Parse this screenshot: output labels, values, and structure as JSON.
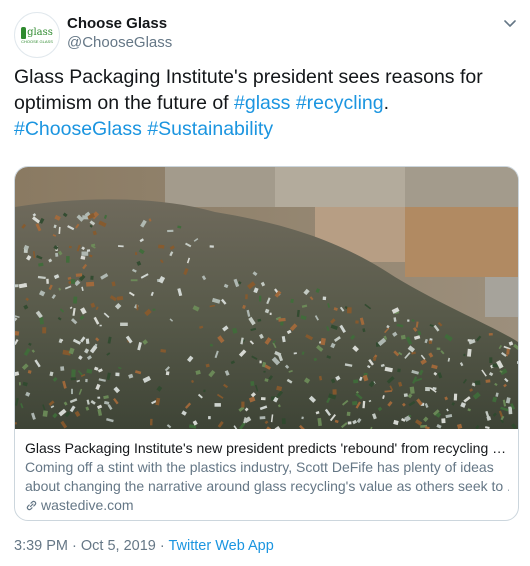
{
  "author": {
    "name": "Choose Glass",
    "handle": "@ChooseGlass",
    "avatar_text": "glass",
    "avatar_subtext": "CHOOSE GLASS"
  },
  "tweet": {
    "text_main": "Glass Packaging Institute's president sees reasons for optimism on the future of ",
    "hashtag_glass": "#glass",
    "hashtag_recycling": "#recycling",
    "period": ".",
    "hashtag_chooseglass": "#ChooseGlass",
    "hashtag_sustainability": "#Sustainability"
  },
  "card": {
    "title": "Glass Packaging Institute's new president predicts 'rebound' from recycling c...",
    "description_line1": "Coming off a stint with the plastics industry, Scott DeFife has plenty of ideas",
    "description_line2": "about changing the narrative around glass recycling's value as others seek to ...",
    "domain": "wastedive.com",
    "image_icon": "glass-pile-photo"
  },
  "meta": {
    "time": "3:39 PM",
    "separator1": " · ",
    "date": "Oct 5, 2019",
    "separator2": " · ",
    "source": "Twitter Web App"
  },
  "colors": {
    "link": "#1b95e0",
    "secondary_text": "#657786",
    "primary_text": "#14171a",
    "brand_green": "#2f8a2f"
  }
}
